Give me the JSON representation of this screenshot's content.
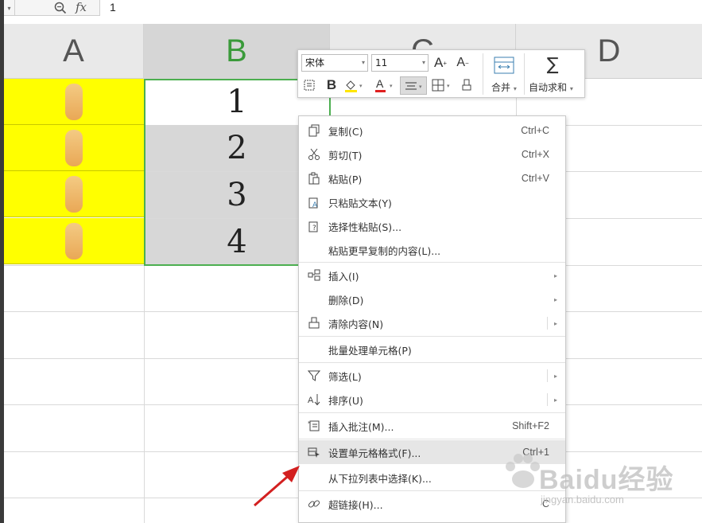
{
  "formula_bar": {
    "fx_label": "fx",
    "value": "1"
  },
  "columns": [
    {
      "label": "A"
    },
    {
      "label": "B"
    },
    {
      "label": "C"
    },
    {
      "label": "D"
    }
  ],
  "cells_b": [
    "1",
    "2",
    "3",
    "4"
  ],
  "mini_toolbar": {
    "font_name": "宋体",
    "font_size": "11",
    "merge_label": "合并",
    "autosum_label": "自动求和"
  },
  "context_menu": {
    "items": [
      {
        "label": "复制(C)",
        "shortcut": "Ctrl+C"
      },
      {
        "label": "剪切(T)",
        "shortcut": "Ctrl+X"
      },
      {
        "label": "粘贴(P)",
        "shortcut": "Ctrl+V"
      },
      {
        "label": "只粘贴文本(Y)",
        "shortcut": ""
      },
      {
        "label": "选择性粘贴(S)...",
        "shortcut": ""
      },
      {
        "label": "粘贴更早复制的内容(L)...",
        "shortcut": ""
      },
      {
        "label": "插入(I)",
        "shortcut": ""
      },
      {
        "label": "删除(D)",
        "shortcut": ""
      },
      {
        "label": "清除内容(N)",
        "shortcut": ""
      },
      {
        "label": "批量处理单元格(P)",
        "shortcut": ""
      },
      {
        "label": "筛选(L)",
        "shortcut": ""
      },
      {
        "label": "排序(U)",
        "shortcut": ""
      },
      {
        "label": "插入批注(M)...",
        "shortcut": "Shift+F2"
      },
      {
        "label": "设置单元格格式(F)...",
        "shortcut": "Ctrl+1"
      },
      {
        "label": "从下拉列表中选择(K)...",
        "shortcut": ""
      },
      {
        "label": "超链接(H)...",
        "shortcut": "C"
      }
    ]
  },
  "watermark": {
    "logo": "Baidu经验",
    "url": "jingyan.baidu.com"
  },
  "colors": {
    "highlight_cell": "#ffff00",
    "selection": "#4caf50",
    "arrow": "#d32020"
  }
}
